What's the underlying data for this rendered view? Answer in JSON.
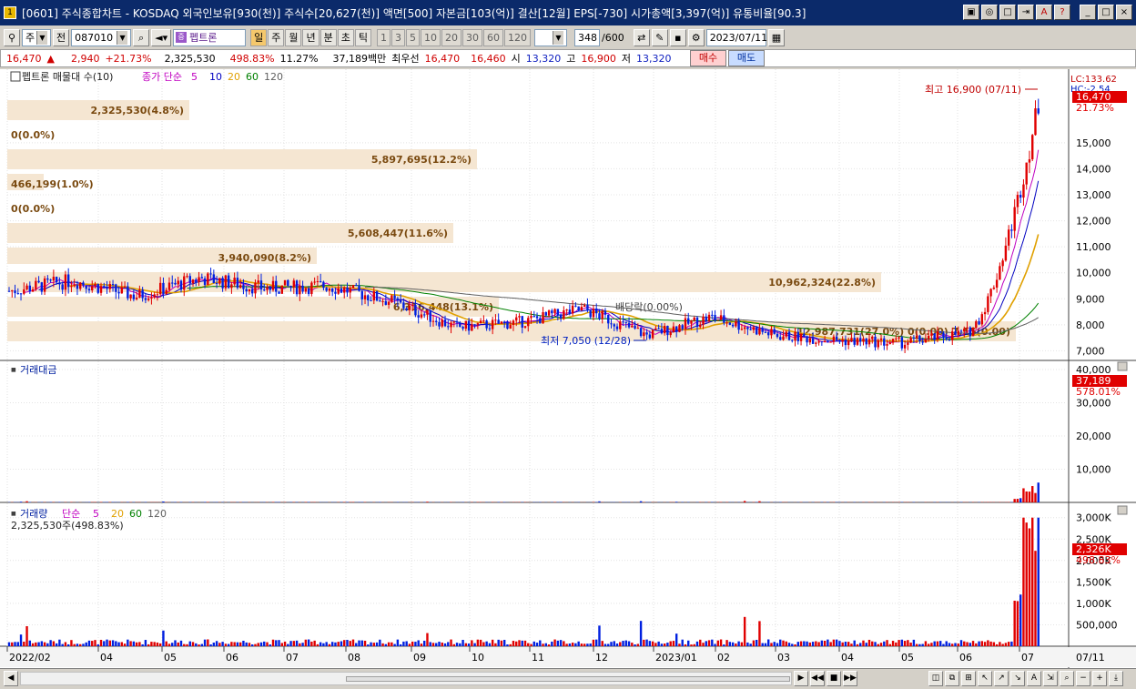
{
  "window": {
    "title": "[0601] 주식종합차트 - KOSDAQ 외국인보유[930(천)] 주식수[20,627(천)] 액면[500] 자본금[103(억)] 결산[12월] EPS[-730] 시가총액[3,397(억)] 유통비율[90.3]",
    "icon_text": "1",
    "buttons": [
      "▣",
      "◎",
      "□",
      "⇥",
      "A",
      "?"
    ],
    "controls": [
      "_",
      "□",
      "×"
    ]
  },
  "toolbar": {
    "market_select": "주",
    "prev_label": "전",
    "code": "087010",
    "stock_name": "펩트론",
    "stock_icon": "증",
    "periods": [
      {
        "label": "일",
        "on": true
      },
      {
        "label": "주",
        "on": false
      },
      {
        "label": "월",
        "on": false
      },
      {
        "label": "년",
        "on": false
      },
      {
        "label": "분",
        "on": false
      },
      {
        "label": "초",
        "on": false
      },
      {
        "label": "틱",
        "on": false
      }
    ],
    "intervals": [
      "1",
      "3",
      "5",
      "10",
      "20",
      "30",
      "60",
      "120"
    ],
    "count": "348",
    "count_total": "/600",
    "date": "2023/07/11"
  },
  "quote": {
    "price": "16,470",
    "change": "2,940",
    "change_pct": "+21.73%",
    "volume": "2,325,530",
    "volume_pct": "498.83%",
    "turnover": "11.27%",
    "amount": "37,189백만",
    "best_label": "최우선",
    "ask": "16,470",
    "bid": "16,460",
    "open_label": "시",
    "open": "13,320",
    "high_label": "고",
    "high": "16,900",
    "low_label": "저",
    "low": "13,320",
    "buy_label": "매수",
    "sell_label": "매도"
  },
  "panels": {
    "price": {
      "legend_name": "펩트론 매물대 수(10)",
      "legend_ma_label": "종가 단순",
      "ma_periods": [
        "5",
        "10",
        "20",
        "60",
        "120"
      ],
      "ma_colors": [
        "#c000c0",
        "#0000c0",
        "#e0a000",
        "#008000",
        "#606060"
      ],
      "lc_label": "LC:133.62",
      "hc_label": "HC:-2.54",
      "last_price": "16,470",
      "last_pct": "21.73%",
      "high_note": "최고 16,900 (07/11)",
      "low_note": "최저 7,050 (12/28)",
      "rights_note": "배당락(0.00%)",
      "y_ticks": [
        "15,000",
        "14,000",
        "13,000",
        "12,000",
        "11,000",
        "10,000",
        "9,000",
        "8,000",
        "7,000"
      ],
      "y_values": [
        15000,
        14000,
        13000,
        12000,
        11000,
        10000,
        9000,
        8000,
        7000
      ],
      "volume_profile": [
        {
          "label": "2,325,530(4.8%)",
          "value": 4.8
        },
        {
          "label": "0(0.0%)",
          "value": 0
        },
        {
          "label": "5,897,695(12.2%)",
          "value": 12.2
        },
        {
          "label": "466,199(1.0%)",
          "value": 1.0
        },
        {
          "label": "0(0.0%)",
          "value": 0
        },
        {
          "label": "5,608,447(11.6%)",
          "value": 11.6
        },
        {
          "label": "3,940,090(8.2%)",
          "value": 8.2
        },
        {
          "label": "10,962,324(22.8%)",
          "value": 22.8
        },
        {
          "label": "6,316,448(13.1%)",
          "value": 13.1
        },
        {
          "label": "12,987,731(27.0%) 0(0.00) 7,15(0.00)",
          "value": 27.0
        }
      ]
    },
    "amount": {
      "legend": "거래대금",
      "last": "37,189",
      "last_pct": "578.01%",
      "y_ticks": [
        "40,000",
        "30,000",
        "20,000",
        "10,000"
      ],
      "y_values": [
        40000,
        30000,
        20000,
        10000
      ]
    },
    "volume": {
      "legend": "거래량",
      "legend_ma": "단순",
      "ma_periods": [
        "5",
        "20",
        "60",
        "120"
      ],
      "sub": "2,325,530주(498.83%)",
      "last": "2,326K",
      "last_pct": "498.83%",
      "y_ticks": [
        "3,000K",
        "2,500K",
        "2,000K",
        "1,500K",
        "1,000K",
        "500,000"
      ],
      "y_values": [
        3000,
        2500,
        2000,
        1500,
        1000,
        500
      ]
    }
  },
  "x_axis": [
    "2022/02",
    "04",
    "05",
    "06",
    "07",
    "08",
    "09",
    "10",
    "11",
    "12",
    "2023/01",
    "02",
    "03",
    "04",
    "05",
    "06",
    "07",
    "07/11"
  ],
  "chart_data": {
    "type": "candlestick",
    "title": "펩트론",
    "x": [
      "2022/02",
      "04",
      "05",
      "06",
      "07",
      "08",
      "09",
      "10",
      "11",
      "12",
      "2023/01",
      "02",
      "03",
      "04",
      "05",
      "06",
      "07"
    ],
    "close": [
      9300,
      9700,
      9100,
      9800,
      9400,
      9500,
      8900,
      7900,
      8100,
      8600,
      7600,
      8300,
      7600,
      7400,
      7300,
      7700,
      16470
    ],
    "ylim": [
      6700,
      17200
    ],
    "amount_ylim": [
      0,
      40000
    ],
    "volume_ylim": [
      0,
      3100
    ]
  },
  "statusbar": {
    "nav_buttons": [
      "▶",
      "◀◀",
      "■",
      "▶▶"
    ],
    "tool_buttons": [
      "◫",
      "⧉",
      "⊞",
      "↖",
      "↗",
      "↘",
      "A",
      "⇲",
      "⌕",
      "−",
      "+",
      "⤓"
    ]
  }
}
